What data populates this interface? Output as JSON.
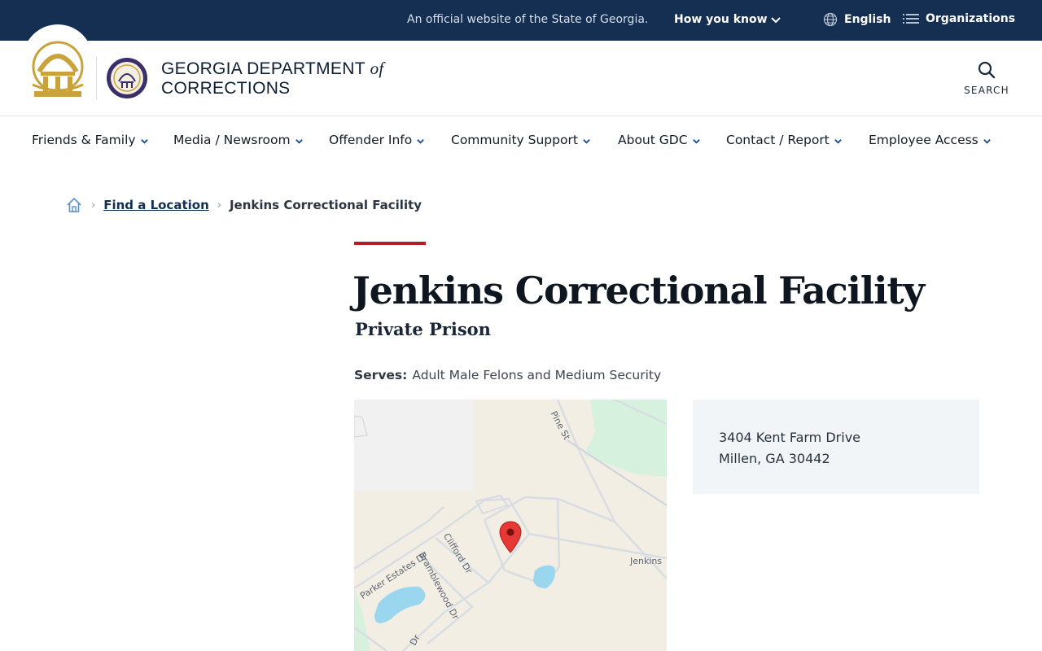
{
  "topbar": {
    "official": "An official website of the State of Georgia.",
    "how_you_know": "How you know",
    "language": "English",
    "organizations": "Organizations"
  },
  "header": {
    "brand_line1": "GEORGIA DEPARTMENT",
    "brand_of": "of",
    "brand_line2": "CORRECTIONS",
    "search_label": "SEARCH"
  },
  "nav": {
    "items": [
      {
        "label": "Friends & Family"
      },
      {
        "label": "Media / Newsroom"
      },
      {
        "label": "Offender Info"
      },
      {
        "label": "Community Support"
      },
      {
        "label": "About GDC"
      },
      {
        "label": "Contact / Report"
      },
      {
        "label": "Employee Access"
      }
    ]
  },
  "breadcrumb": {
    "parent": "Find a Location",
    "current": "Jenkins Correctional Facility"
  },
  "facility": {
    "name": "Jenkins Correctional Facility",
    "type": "Private Prison",
    "serves_label": "Serves:",
    "serves_value": "Adult Male Felons and Medium Security",
    "address_line1": "3404 Kent Farm Drive",
    "address_line2": "Millen, GA 30442"
  },
  "map": {
    "labels": {
      "pine": "Pine St",
      "clifford": "Clifford Dr",
      "parker": "Parker Estates Dr",
      "bramblewood": "Bramblewood Dr",
      "jenkins": "Jenkins",
      "dr": "Dr"
    }
  },
  "colors": {
    "banner": "#142f52",
    "accent_red": "#b21f26",
    "seal_gold": "#c9a33a",
    "map_pin": "#e53935"
  }
}
